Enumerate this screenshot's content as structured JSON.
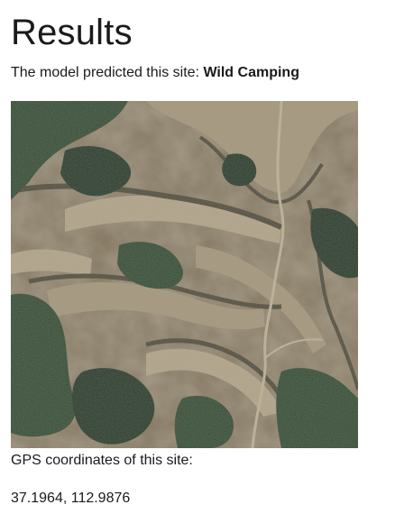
{
  "page": {
    "title": "Results",
    "prediction_prefix": "The model predicted this site:",
    "prediction_value": "Wild Camping",
    "gps_label": "GPS coordinates of this site:",
    "gps_value": "37.1964, 112.9876"
  },
  "image": {
    "icon": "satellite-image",
    "palette": {
      "ground": "#7d6f57",
      "terrace_light": "#a89a80",
      "terrace_pale": "#b7a98e",
      "ridge_dark": "#4d4a3c",
      "forest": "#2f4a33",
      "forest_dark": "#23382a",
      "track": "#c4b79c"
    }
  }
}
